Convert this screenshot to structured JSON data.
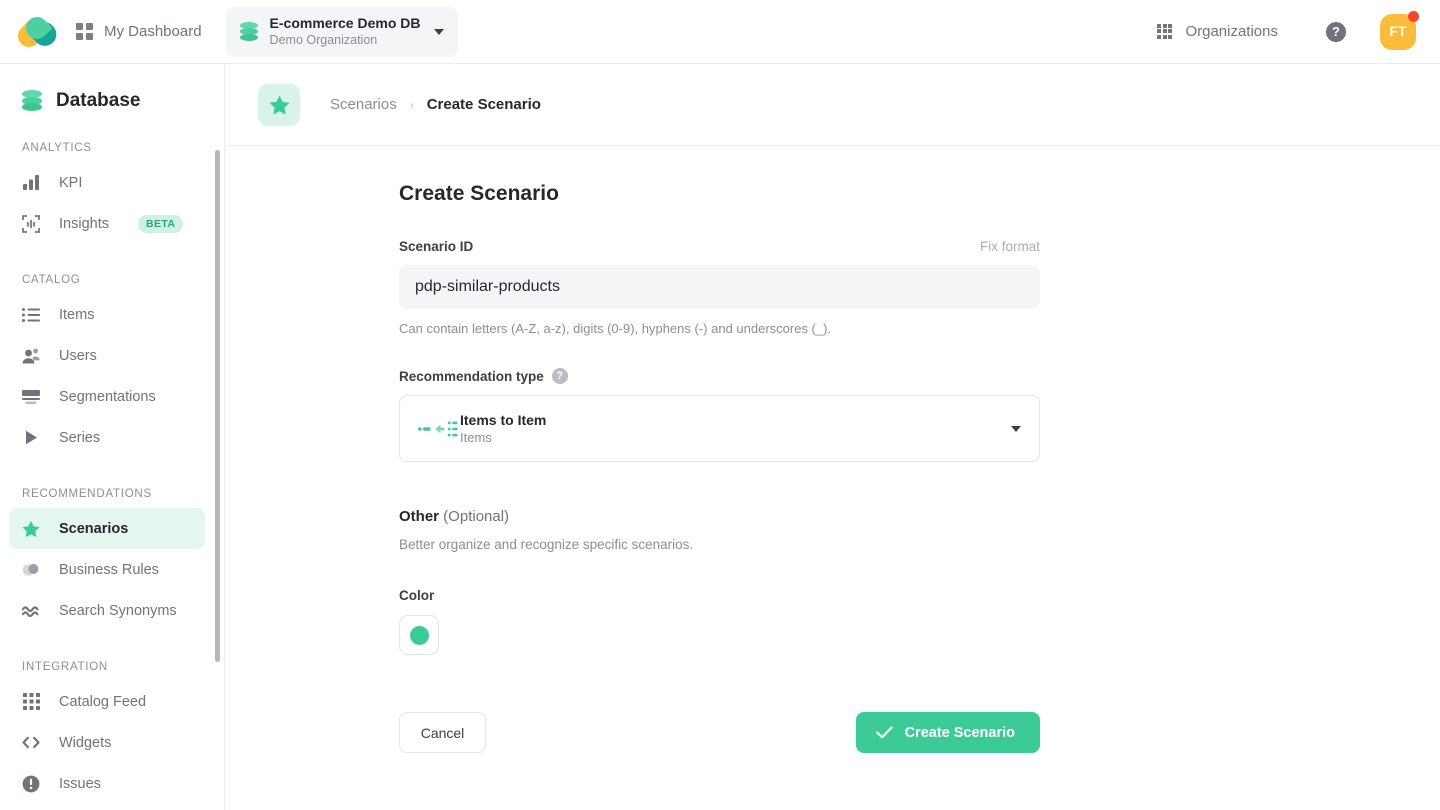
{
  "topbar": {
    "logo_name": "brand-logo",
    "dashboard_label": "My Dashboard",
    "org": {
      "name": "E-commerce Demo DB",
      "subtitle": "Demo Organization"
    },
    "organizations_label": "Organizations",
    "help_label": "?",
    "avatar_initials": "FT"
  },
  "sidebar": {
    "title": "Database",
    "sections": [
      {
        "label": "ANALYTICS",
        "items": [
          {
            "label": "KPI",
            "icon": "bar-chart-icon",
            "active": false
          },
          {
            "label": "Insights",
            "icon": "insights-icon",
            "active": false,
            "badge": "BETA"
          }
        ]
      },
      {
        "label": "CATALOG",
        "items": [
          {
            "label": "Items",
            "icon": "list-icon",
            "active": false
          },
          {
            "label": "Users",
            "icon": "users-icon",
            "active": false
          },
          {
            "label": "Segmentations",
            "icon": "segmentations-icon",
            "active": false
          },
          {
            "label": "Series",
            "icon": "play-triangle-icon",
            "active": false
          }
        ]
      },
      {
        "label": "RECOMMENDATIONS",
        "items": [
          {
            "label": "Scenarios",
            "icon": "star-icon",
            "active": true
          },
          {
            "label": "Business Rules",
            "icon": "business-rules-icon",
            "active": false
          },
          {
            "label": "Search Synonyms",
            "icon": "approx-equal-icon",
            "active": false
          }
        ]
      },
      {
        "label": "INTEGRATION",
        "items": [
          {
            "label": "Catalog Feed",
            "icon": "grid-dots-icon",
            "active": false
          },
          {
            "label": "Widgets",
            "icon": "code-brackets-icon",
            "active": false
          },
          {
            "label": "Issues",
            "icon": "exclamation-circle-icon",
            "active": false
          }
        ]
      }
    ]
  },
  "breadcrumb": {
    "icon": "star-icon",
    "parent": "Scenarios",
    "separator": "›",
    "current": "Create Scenario"
  },
  "main": {
    "page_title": "Create Scenario",
    "scenario_id": {
      "label": "Scenario ID",
      "action_label": "Fix format",
      "value": "pdp-similar-products",
      "placeholder": "Scenario ID",
      "helper": "Can contain letters (A-Z, a-z), digits (0-9), hyphens (-) and underscores (_)."
    },
    "recommendation_type": {
      "label": "Recommendation type",
      "help_glyph": "?",
      "selected_title": "Items to Item",
      "selected_subtitle": "Items"
    },
    "other": {
      "heading_bold": "Other",
      "heading_rest": " (Optional)",
      "description": "Better organize and recognize specific scenarios."
    },
    "color": {
      "label": "Color",
      "value": "#3CCB96"
    },
    "buttons": {
      "cancel": "Cancel",
      "create": "Create Scenario"
    }
  },
  "colors": {
    "accent": "#3CCB96",
    "accent_soft": "#E3F7EF",
    "badge_bg": "#CFF0E2",
    "badge_text": "#2BA77B",
    "avatar_bg": "#FBBC3C",
    "notification_dot": "#F4462F"
  }
}
